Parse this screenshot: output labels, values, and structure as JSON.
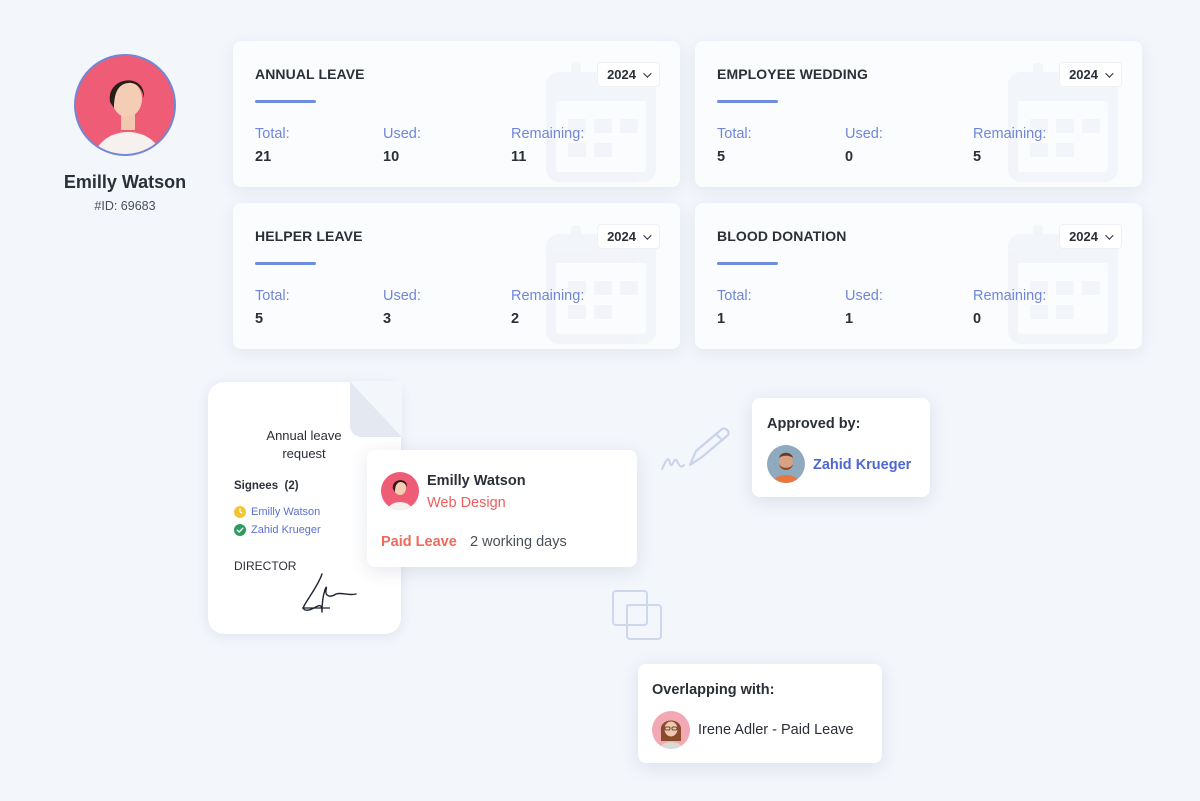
{
  "profile": {
    "name": "Emilly Watson",
    "id_label": "#ID: 69683"
  },
  "leave_cards": [
    {
      "title": "ANNUAL LEAVE",
      "year": "2024",
      "total_label": "Total:",
      "total": "21",
      "used_label": "Used:",
      "used": "10",
      "remaining_label": "Remaining:",
      "remaining": "11"
    },
    {
      "title": "EMPLOYEE WEDDING",
      "year": "2024",
      "total_label": "Total:",
      "total": "5",
      "used_label": "Used:",
      "used": "0",
      "remaining_label": "Remaining:",
      "remaining": "5"
    },
    {
      "title": "HELPER LEAVE",
      "year": "2024",
      "total_label": "Total:",
      "total": "5",
      "used_label": "Used:",
      "used": "3",
      "remaining_label": "Remaining:",
      "remaining": "2"
    },
    {
      "title": "BLOOD DONATION",
      "year": "2024",
      "total_label": "Total:",
      "total": "1",
      "used_label": "Used:",
      "used": "1",
      "remaining_label": "Remaining:",
      "remaining": "0"
    }
  ],
  "document": {
    "title": "Annual leave request",
    "signees_label": "Signees  (2)",
    "signees": [
      {
        "name": "Emilly Watson",
        "status": "pending"
      },
      {
        "name": "Zahid Krueger",
        "status": "approved"
      }
    ],
    "role": "DIRECTOR"
  },
  "request": {
    "name": "Emilly Watson",
    "department": "Web Design",
    "leave_type": "Paid Leave",
    "duration": "2 working days"
  },
  "approval": {
    "label": "Approved by:",
    "approver": "Zahid Krueger"
  },
  "overlap": {
    "label": "Overlapping with:",
    "text": "Irene Adler - Paid Leave"
  },
  "icons": {
    "year_dropdown": "chevron-down-icon",
    "pending": "clock-icon",
    "approved": "check-circle-icon",
    "decor_sign": "pen-signature-icon",
    "decor_overlap": "overlap-squares-icon",
    "card_bg": "calendar-icon"
  },
  "colors": {
    "accent": "#6f87d9",
    "approver_name": "#4f67d1",
    "paid_leave": "#ee6a5a",
    "department": "#ee5c5c",
    "pending": "#f4c531",
    "approved": "#2d9c61",
    "background": "#f3f6fb"
  }
}
